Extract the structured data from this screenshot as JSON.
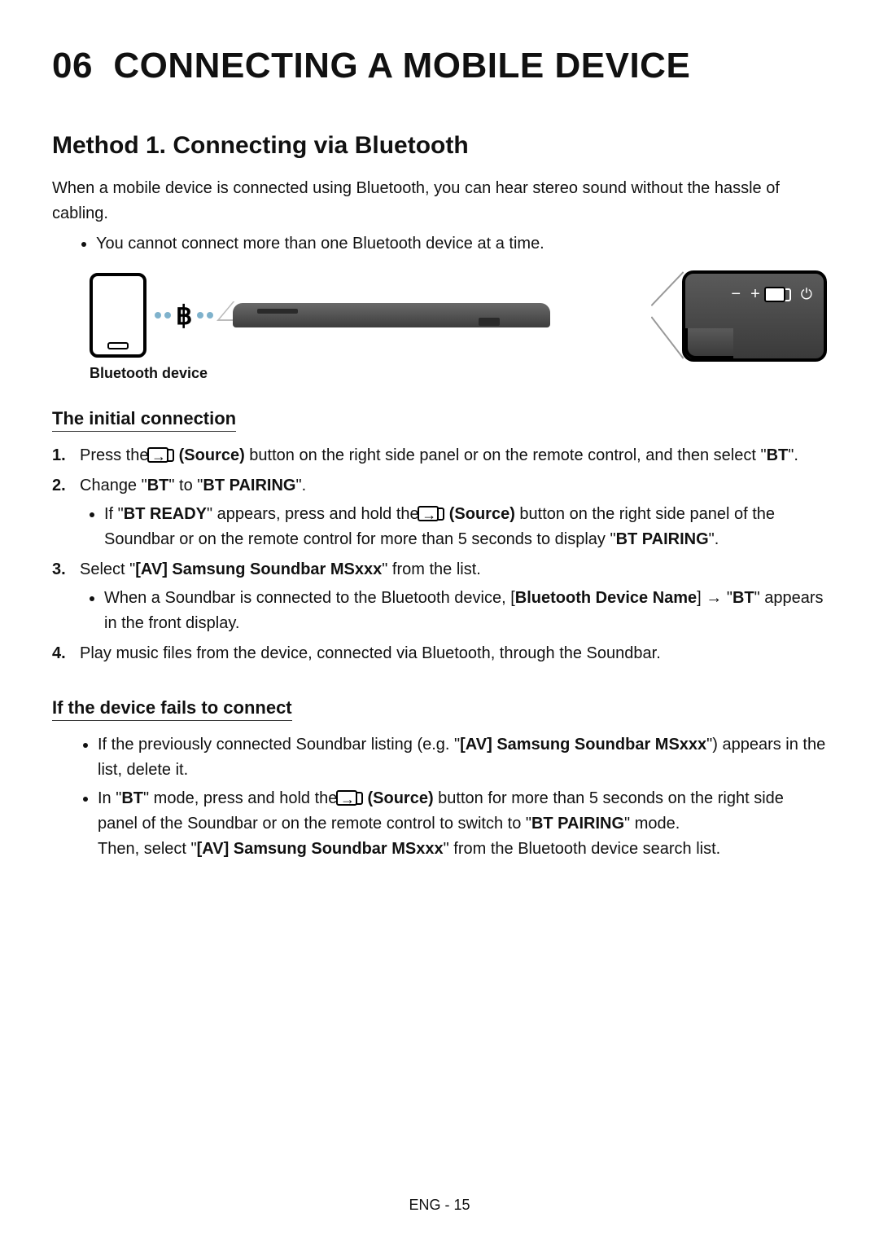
{
  "section": {
    "number": "06",
    "title": "CONNECTING A MOBILE DEVICE"
  },
  "method1": {
    "title": "Method 1. Connecting via Bluetooth",
    "intro": "When a mobile device is connected using Bluetooth, you can hear stereo sound without the hassle of cabling.",
    "note": "You cannot connect more than one Bluetooth device at a time."
  },
  "diagram": {
    "device_label": "Bluetooth device",
    "zoom_icons": {
      "minus": "−",
      "plus": "+",
      "source": "⏵",
      "power": "⏻"
    }
  },
  "initial": {
    "heading": "The initial connection",
    "step1_a": "Press the ",
    "step1_b": " (Source)",
    "step1_c": " button on the right side panel or on the remote control, and then select \"",
    "step1_d": "BT",
    "step1_e": "\".",
    "step2_a": "Change \"",
    "step2_b": "BT",
    "step2_c": "\" to \"",
    "step2_d": "BT PAIRING",
    "step2_e": "\".",
    "step2_sub_a": "If \"",
    "step2_sub_b": "BT READY",
    "step2_sub_c": "\" appears, press and hold the ",
    "step2_sub_d": " (Source)",
    "step2_sub_e": " button on the right side panel of the Soundbar or on the remote control for more than 5 seconds to display \"",
    "step2_sub_f": "BT PAIRING",
    "step2_sub_g": "\".",
    "step3_a": "Select \"",
    "step3_b": "[AV] Samsung Soundbar MSxxx",
    "step3_c": "\" from the list.",
    "step3_sub_a": "When a Soundbar is connected to the Bluetooth device, [",
    "step3_sub_b": "Bluetooth Device Name",
    "step3_sub_c": "] → \"",
    "step3_sub_d": "BT",
    "step3_sub_e": "\" appears in the front display.",
    "step4": "Play music files from the device, connected via Bluetooth, through the Soundbar."
  },
  "fails": {
    "heading": "If the device fails to connect",
    "b1_a": "If the previously connected Soundbar listing (e.g. \"",
    "b1_b": "[AV] Samsung Soundbar MSxxx",
    "b1_c": "\") appears in the list, delete it.",
    "b2_a": "In \"",
    "b2_b": "BT",
    "b2_c": "\" mode, press and hold the ",
    "b2_d": " (Source)",
    "b2_e": " button for more than 5 seconds on the right side panel of the Soundbar or on the remote control to switch to \"",
    "b2_f": "BT PAIRING",
    "b2_g": "\" mode.",
    "b2_h": "Then, select \"",
    "b2_i": "[AV] Samsung Soundbar MSxxx",
    "b2_j": "\" from the Bluetooth device search list."
  },
  "footer": {
    "page": "ENG - 15"
  }
}
